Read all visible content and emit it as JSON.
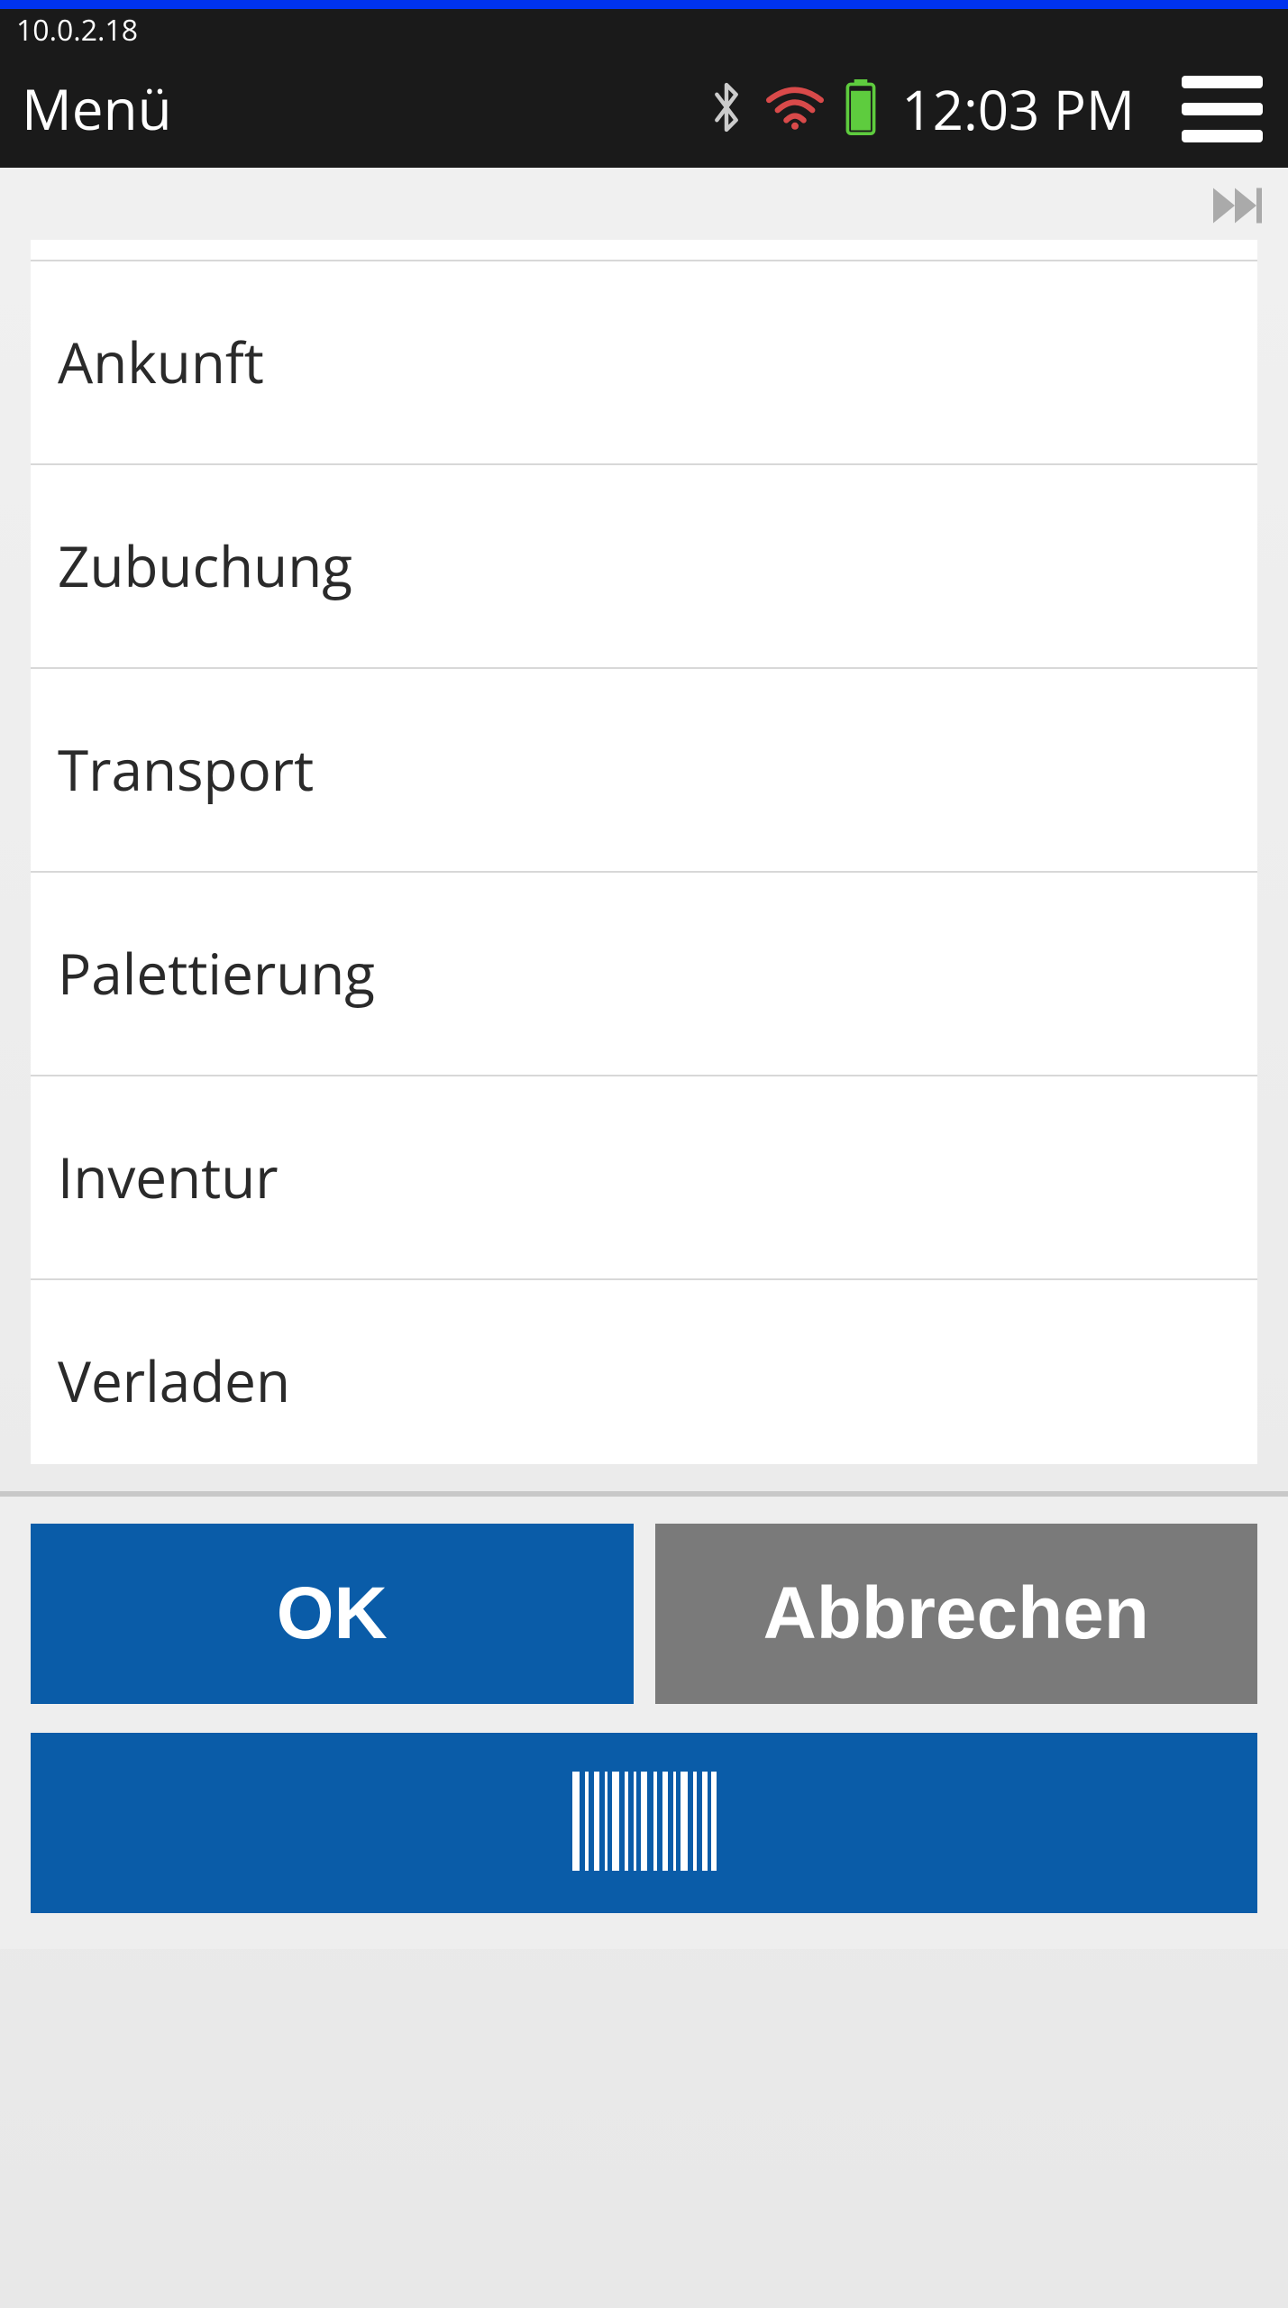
{
  "status_bar": {
    "ip": "10.0.2.18"
  },
  "header": {
    "title": "Menü",
    "time": "12:03 PM"
  },
  "menu": {
    "items": [
      {
        "label": "Ankunft"
      },
      {
        "label": "Zubuchung"
      },
      {
        "label": "Transport"
      },
      {
        "label": "Palettierung"
      },
      {
        "label": "Inventur"
      },
      {
        "label": "Verladen"
      }
    ]
  },
  "footer": {
    "ok_label": "OK",
    "cancel_label": "Abbrechen"
  },
  "colors": {
    "primary": "#0a5ca8",
    "secondary": "#7a7a7a",
    "header_bg": "#1a1a1a",
    "wifi": "#d94a4a",
    "battery": "#5ecc3e"
  }
}
